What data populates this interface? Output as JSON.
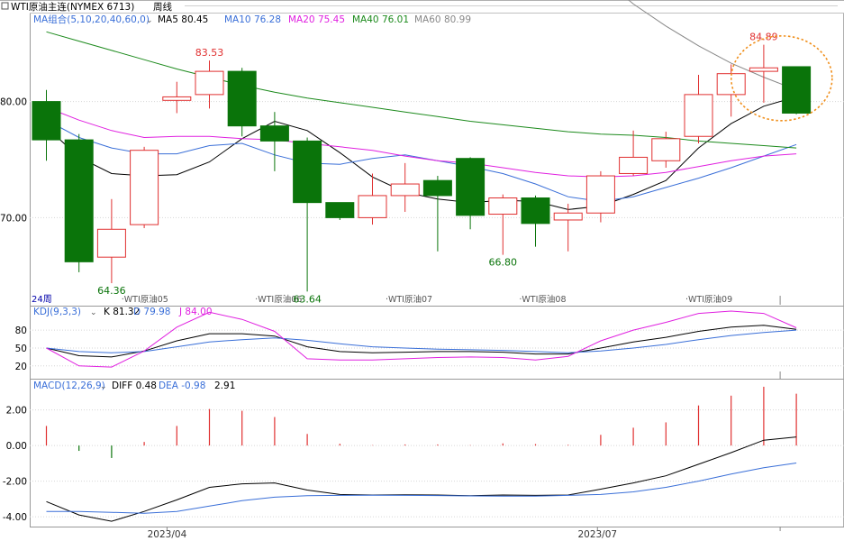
{
  "header": {
    "title": "WTI原油主连(NYMEX 6713)",
    "period": "周线"
  },
  "ma_legend": {
    "label": "MA组合(5,10,20,40,60,0)",
    "items": [
      {
        "text": "MA5 80.45",
        "color": "#000000"
      },
      {
        "text": "MA10 76.28",
        "color": "#3a6fd8"
      },
      {
        "text": "MA20 75.45",
        "color": "#e020e0"
      },
      {
        "text": "MA40 76.01",
        "color": "#1c8a1c"
      },
      {
        "text": "MA60 80.99",
        "color": "#888888"
      }
    ]
  },
  "kdj_legend": {
    "label": "KDJ(9,3,3)",
    "items": [
      {
        "text": "K 81.32",
        "color": "#000000"
      },
      {
        "text": "D 79.98",
        "color": "#3a6fd8"
      },
      {
        "text": "J 84.00",
        "color": "#e020e0"
      }
    ]
  },
  "macd_legend": {
    "label": "MACD(12,26,9)",
    "items": [
      {
        "text": "DIFF 0.48",
        "color": "#000000"
      },
      {
        "text": "DEA -0.98",
        "color": "#3a6fd8"
      },
      {
        "text": "2.91",
        "color": "#000000"
      }
    ]
  },
  "period_note": "24周",
  "contract_markers": [
    "WTI原油05",
    "WTI原油06",
    "WTI原油07",
    "WTI原油08",
    "WTI原油09"
  ],
  "x_axis_labels": [
    "2023/04",
    "2023/07"
  ],
  "annotations": [
    "83.53",
    "84.89",
    "64.36",
    "63.64",
    "66.80"
  ],
  "colors": {
    "up": "#e03030",
    "down": "#0a740a",
    "grid": "#cccccc",
    "highlight": "#f0901e"
  },
  "chart_data": {
    "type": "candlestick",
    "title": "WTI原油主连(NYMEX 6713)",
    "price_axis": {
      "ticks": [
        70.0,
        80.0
      ],
      "tick_labels": [
        "70.00",
        "80.00"
      ],
      "ylim": [
        62.5,
        87.5
      ]
    },
    "candles": [
      {
        "open": 80.0,
        "high": 81.0,
        "low": 74.9,
        "close": 76.7
      },
      {
        "open": 76.7,
        "high": 77.2,
        "low": 65.3,
        "close": 66.2
      },
      {
        "open": 66.6,
        "high": 71.6,
        "low": 64.36,
        "close": 69.0
      },
      {
        "open": 69.4,
        "high": 76.1,
        "low": 69.1,
        "close": 75.8
      },
      {
        "open": 80.1,
        "high": 81.7,
        "low": 79.0,
        "close": 80.4
      },
      {
        "open": 80.6,
        "high": 83.53,
        "low": 79.4,
        "close": 82.6
      },
      {
        "open": 82.6,
        "high": 82.9,
        "low": 77.0,
        "close": 77.9
      },
      {
        "open": 77.9,
        "high": 79.1,
        "low": 74.0,
        "close": 76.6
      },
      {
        "open": 76.6,
        "high": 76.9,
        "low": 63.64,
        "close": 71.3
      },
      {
        "open": 71.3,
        "high": 71.3,
        "low": 69.8,
        "close": 70.0
      },
      {
        "open": 70.0,
        "high": 73.8,
        "low": 69.4,
        "close": 71.9
      },
      {
        "open": 71.9,
        "high": 74.7,
        "low": 70.5,
        "close": 72.9
      },
      {
        "open": 73.2,
        "high": 73.6,
        "low": 67.1,
        "close": 71.9
      },
      {
        "open": 75.1,
        "high": 75.2,
        "low": 69.0,
        "close": 70.2
      },
      {
        "open": 70.3,
        "high": 72.0,
        "low": 66.8,
        "close": 71.7
      },
      {
        "open": 71.7,
        "high": 71.9,
        "low": 67.5,
        "close": 69.5
      },
      {
        "open": 69.8,
        "high": 71.2,
        "low": 67.1,
        "close": 70.4
      },
      {
        "open": 70.4,
        "high": 74.0,
        "low": 69.6,
        "close": 73.6
      },
      {
        "open": 73.8,
        "high": 77.5,
        "low": 73.6,
        "close": 75.2
      },
      {
        "open": 74.9,
        "high": 77.4,
        "low": 74.3,
        "close": 76.8
      },
      {
        "open": 77.0,
        "high": 82.3,
        "low": 76.4,
        "close": 80.6
      },
      {
        "open": 80.6,
        "high": 83.2,
        "low": 78.7,
        "close": 82.4
      },
      {
        "open": 82.6,
        "high": 84.89,
        "low": 79.9,
        "close": 82.9
      },
      {
        "open": 83.0,
        "high": 83.0,
        "low": 78.9,
        "close": 79.0
      }
    ],
    "ma": [
      {
        "name": "MA5",
        "color": "#000000",
        "values": [
          77.8,
          75.2,
          73.8,
          73.6,
          73.7,
          74.8,
          76.8,
          78.3,
          77.5,
          75.6,
          73.5,
          72.2,
          71.6,
          71.3,
          71.5,
          71.4,
          70.7,
          71.0,
          72.0,
          73.2,
          76.0,
          78.1,
          79.6,
          80.4
        ]
      },
      {
        "name": "MA10",
        "color": "#3a6fd8",
        "values": [
          78.4,
          76.9,
          76.0,
          75.5,
          75.5,
          76.2,
          76.4,
          75.4,
          74.7,
          74.6,
          75.1,
          75.4,
          74.9,
          74.4,
          73.8,
          72.9,
          71.8,
          71.4,
          71.8,
          72.6,
          73.4,
          74.3,
          75.3,
          76.3
        ]
      },
      {
        "name": "MA20",
        "color": "#e020e0",
        "values": [
          79.5,
          78.4,
          77.5,
          76.9,
          77.0,
          77.0,
          76.8,
          76.7,
          76.4,
          76.1,
          75.8,
          75.3,
          74.9,
          74.7,
          74.3,
          73.9,
          73.6,
          73.5,
          73.6,
          73.9,
          74.4,
          74.9,
          75.3,
          75.5
        ]
      },
      {
        "name": "MA40",
        "color": "#1c8a1c",
        "values": [
          86.0,
          85.2,
          84.4,
          83.6,
          82.8,
          82.1,
          81.4,
          80.8,
          80.3,
          79.9,
          79.5,
          79.1,
          78.7,
          78.3,
          78.0,
          77.7,
          77.4,
          77.2,
          77.1,
          76.9,
          76.6,
          76.4,
          76.2,
          76.0
        ]
      },
      {
        "name": "MA60",
        "color": "#888888",
        "values": [
          null,
          null,
          null,
          null,
          null,
          null,
          null,
          null,
          null,
          null,
          null,
          null,
          null,
          null,
          null,
          null,
          94.0,
          90.8,
          88.4,
          86.5,
          84.8,
          83.3,
          82.1,
          81.0
        ]
      }
    ],
    "kdj": {
      "ticks": [
        20,
        50,
        80
      ],
      "ylim": [
        0,
        115
      ],
      "k": [
        50,
        37,
        35,
        45,
        62,
        74,
        74,
        70,
        52,
        44,
        42,
        43,
        44,
        44,
        43,
        40,
        40,
        50,
        60,
        68,
        78,
        85,
        88,
        81.32
      ],
      "d": [
        50,
        44,
        42,
        44,
        52,
        60,
        64,
        67,
        63,
        57,
        52,
        50,
        48,
        47,
        46,
        44,
        42,
        45,
        50,
        56,
        64,
        71,
        76,
        79.98
      ],
      "j": [
        50,
        20,
        18,
        45,
        85,
        110,
        98,
        78,
        32,
        30,
        30,
        32,
        34,
        35,
        34,
        30,
        36,
        62,
        80,
        93,
        108,
        112,
        108,
        84.0
      ]
    },
    "macd": {
      "ticks": [
        2.0,
        0.0,
        -2.0,
        -4.0
      ],
      "tick_labels": [
        "2.00",
        "0.00",
        "-2.00",
        "-4.00"
      ],
      "ylim": [
        -4.5,
        3.6
      ],
      "diff": [
        -3.15,
        -3.9,
        -4.25,
        -3.7,
        -3.05,
        -2.35,
        -2.15,
        -2.1,
        -2.5,
        -2.75,
        -2.78,
        -2.77,
        -2.78,
        -2.82,
        -2.78,
        -2.8,
        -2.78,
        -2.45,
        -2.1,
        -1.7,
        -1.05,
        -0.4,
        0.3,
        0.48
      ],
      "dea": [
        -3.7,
        -3.7,
        -3.75,
        -3.8,
        -3.7,
        -3.4,
        -3.1,
        -2.9,
        -2.82,
        -2.8,
        -2.79,
        -2.8,
        -2.81,
        -2.83,
        -2.84,
        -2.84,
        -2.8,
        -2.75,
        -2.6,
        -2.35,
        -2.0,
        -1.6,
        -1.25,
        -0.98
      ],
      "hist": [
        1.1,
        -0.3,
        -0.7,
        0.2,
        1.1,
        2.05,
        1.95,
        1.6,
        0.65,
        0.1,
        0.02,
        0.06,
        0.06,
        0.02,
        0.12,
        0.08,
        0.04,
        0.6,
        1.0,
        1.3,
        2.25,
        2.8,
        3.3,
        2.91
      ]
    }
  }
}
